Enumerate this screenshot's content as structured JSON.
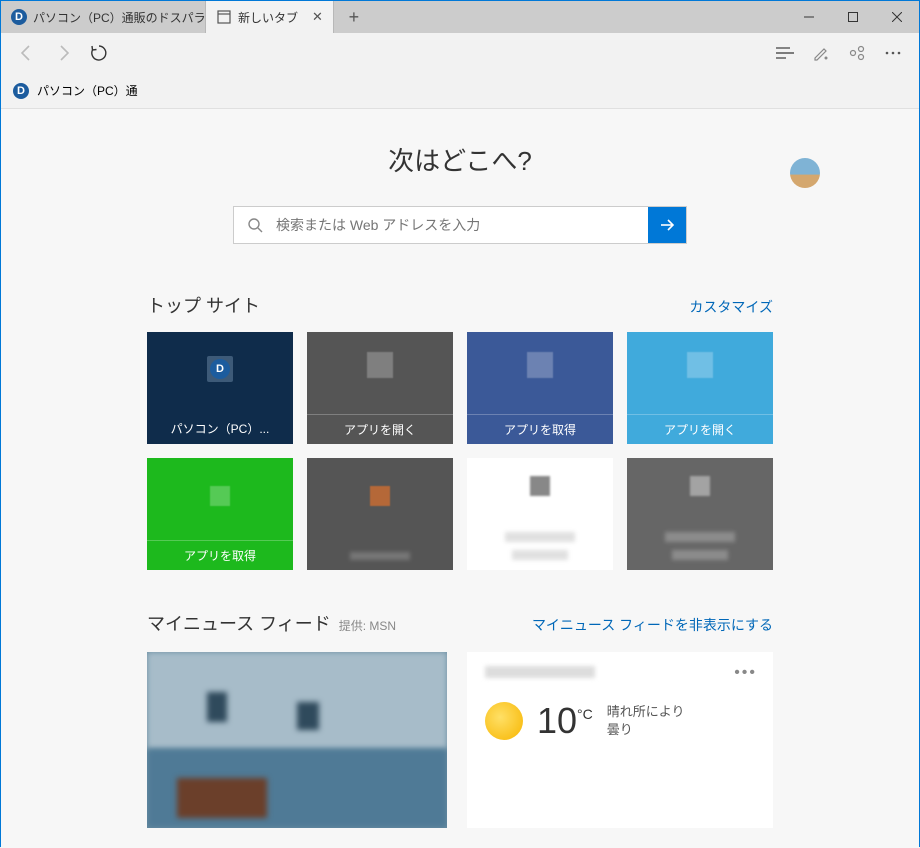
{
  "tabs": [
    {
      "title": "パソコン（PC）通販のドスパラ"
    },
    {
      "title": "新しいタブ"
    }
  ],
  "favorites_bar": {
    "item0": "パソコン（PC）通"
  },
  "hero": {
    "title": "次はどこへ?"
  },
  "search": {
    "placeholder": "検索または Web アドレスを入力"
  },
  "top_sites": {
    "heading": "トップ サイト",
    "customize": "カスタマイズ",
    "tiles": [
      {
        "label": "パソコン（PC）..."
      },
      {
        "label": "アプリを開く"
      },
      {
        "label": "アプリを取得"
      },
      {
        "label": "アプリを開く"
      },
      {
        "label": "アプリを取得"
      },
      {
        "label": ""
      },
      {
        "label": ""
      },
      {
        "label": ""
      }
    ]
  },
  "news": {
    "heading": "マイニュース フィード",
    "provider": "提供: MSN",
    "hide": "マイニュース フィードを非表示にする"
  },
  "weather": {
    "temp_value": "10",
    "temp_unit": "°C",
    "desc_line1": "晴れ所により",
    "desc_line2": "曇り"
  }
}
